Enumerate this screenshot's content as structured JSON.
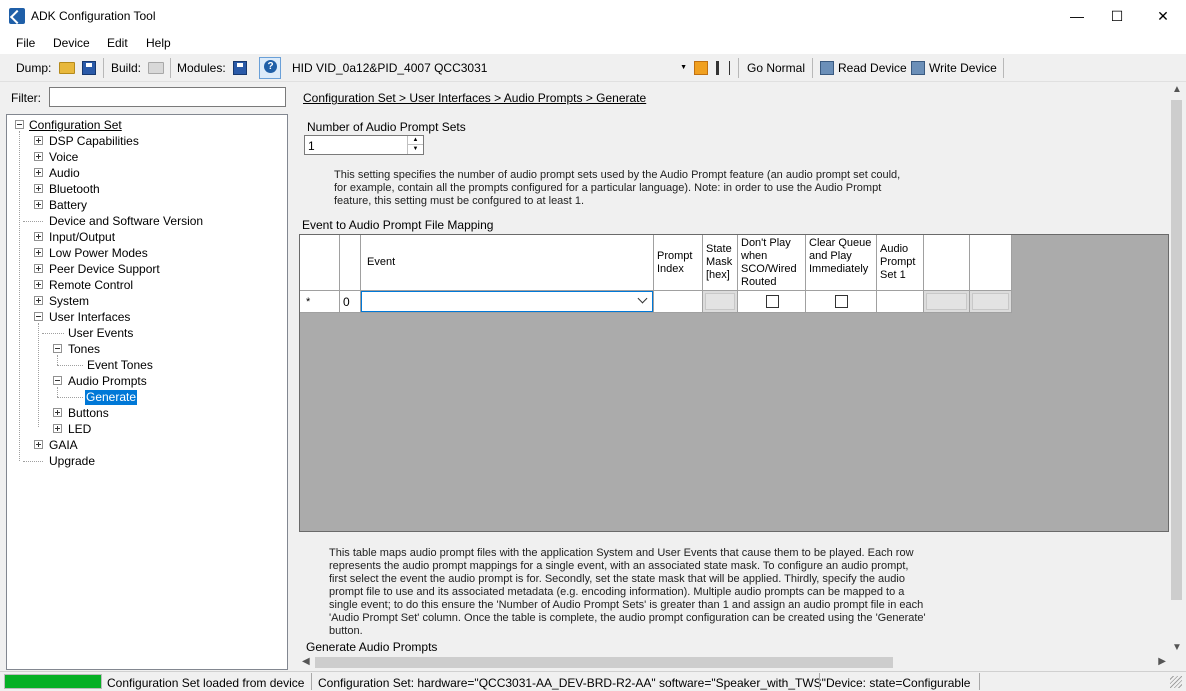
{
  "window": {
    "title": "ADK Configuration Tool",
    "minimize": "—",
    "maximize": "☐",
    "close": "✕"
  },
  "menu": [
    "File",
    "Device",
    "Edit",
    "Help"
  ],
  "toolbar": {
    "dump_label": "Dump:",
    "build_label": "Build:",
    "modules_label": "Modules:",
    "device": "HID VID_0a12&PID_4007 QCC3031",
    "go_normal": "Go Normal",
    "read_device": "Read Device",
    "write_device": "Write Device"
  },
  "filter": {
    "label": "Filter:",
    "value": ""
  },
  "tree": [
    {
      "label": "Configuration Set",
      "expand": "minus"
    },
    {
      "label": "DSP Capabilities",
      "expand": "plus"
    },
    {
      "label": "Voice",
      "expand": "plus"
    },
    {
      "label": "Audio",
      "expand": "plus"
    },
    {
      "label": "Bluetooth",
      "expand": "plus"
    },
    {
      "label": "Battery",
      "expand": "plus"
    },
    {
      "label": "Device and Software Version",
      "expand": "none"
    },
    {
      "label": "Input/Output",
      "expand": "plus"
    },
    {
      "label": "Low Power Modes",
      "expand": "plus"
    },
    {
      "label": "Peer Device Support",
      "expand": "plus"
    },
    {
      "label": "Remote Control",
      "expand": "plus"
    },
    {
      "label": "System",
      "expand": "plus"
    },
    {
      "label": "User Interfaces",
      "expand": "minus"
    },
    {
      "label": "User Events",
      "expand": "none"
    },
    {
      "label": "Tones",
      "expand": "minus"
    },
    {
      "label": "Event Tones",
      "expand": "none"
    },
    {
      "label": "Audio Prompts",
      "expand": "minus"
    },
    {
      "label": "Generate",
      "expand": "none",
      "selected": true
    },
    {
      "label": "Buttons",
      "expand": "plus"
    },
    {
      "label": "LED",
      "expand": "plus"
    },
    {
      "label": "GAIA",
      "expand": "plus"
    },
    {
      "label": "Upgrade",
      "expand": "none"
    }
  ],
  "main": {
    "breadcrumb": "Configuration Set > User Interfaces > Audio Prompts > Generate",
    "num_sets_label": "Number of Audio Prompt Sets",
    "num_sets_value": "1",
    "num_sets_desc": "This setting specifies the number of audio prompt sets used by the Audio Prompt feature (an audio prompt set could, for example, contain all the prompts configured for a particular language). Note: in order to use the Audio Prompt feature, this setting must be confgured to at least 1.",
    "mapping_title": "Event to Audio Prompt File Mapping",
    "columns": [
      "",
      "",
      "Event",
      "Prompt Index",
      "State Mask [hex]",
      "Don't Play when SCO/Wired Routed",
      "Clear Queue and Play Immediately",
      "Audio Prompt Set 1",
      "",
      ""
    ],
    "row": {
      "marker": "*",
      "index": "0"
    },
    "table_desc": "This table maps audio prompt files with the application System and User Events that cause them to be played. Each row represents the audio prompt mappings for a single event, with an associated state mask. To configure an audio prompt, first select the event the audio prompt is for. Secondly, set the state mask that will be applied. Thirdly, specify the audio prompt file to use and its associated metadata (e.g. encoding information). Multiple audio prompts can be mapped to a single event; to do this ensure the 'Number of Audio Prompt Sets' is greater than 1 and assign an audio prompt file in each 'Audio Prompt Set' column. Once the table is complete, the audio prompt configuration can be created using the 'Generate' button.",
    "generate_title": "Generate Audio Prompts"
  },
  "status": {
    "progress": 1.0,
    "loaded": "Configuration Set loaded from device",
    "config_set": "Configuration Set:  hardware=\"QCC3031-AA_DEV-BRD-R2-AA\" software=\"Speaker_with_TWS\"",
    "device_state": "Device:  state=Configurable"
  },
  "colors": {
    "accent": "#0078d7",
    "progress": "#06b025",
    "grid_bg": "#ababab"
  },
  "icons": [
    "app-icon",
    "folder-open-icon",
    "save-icon",
    "folder-gray-icon",
    "help-icon",
    "reset-icon",
    "cable-icon",
    "read-device-icon",
    "write-device-icon"
  ]
}
